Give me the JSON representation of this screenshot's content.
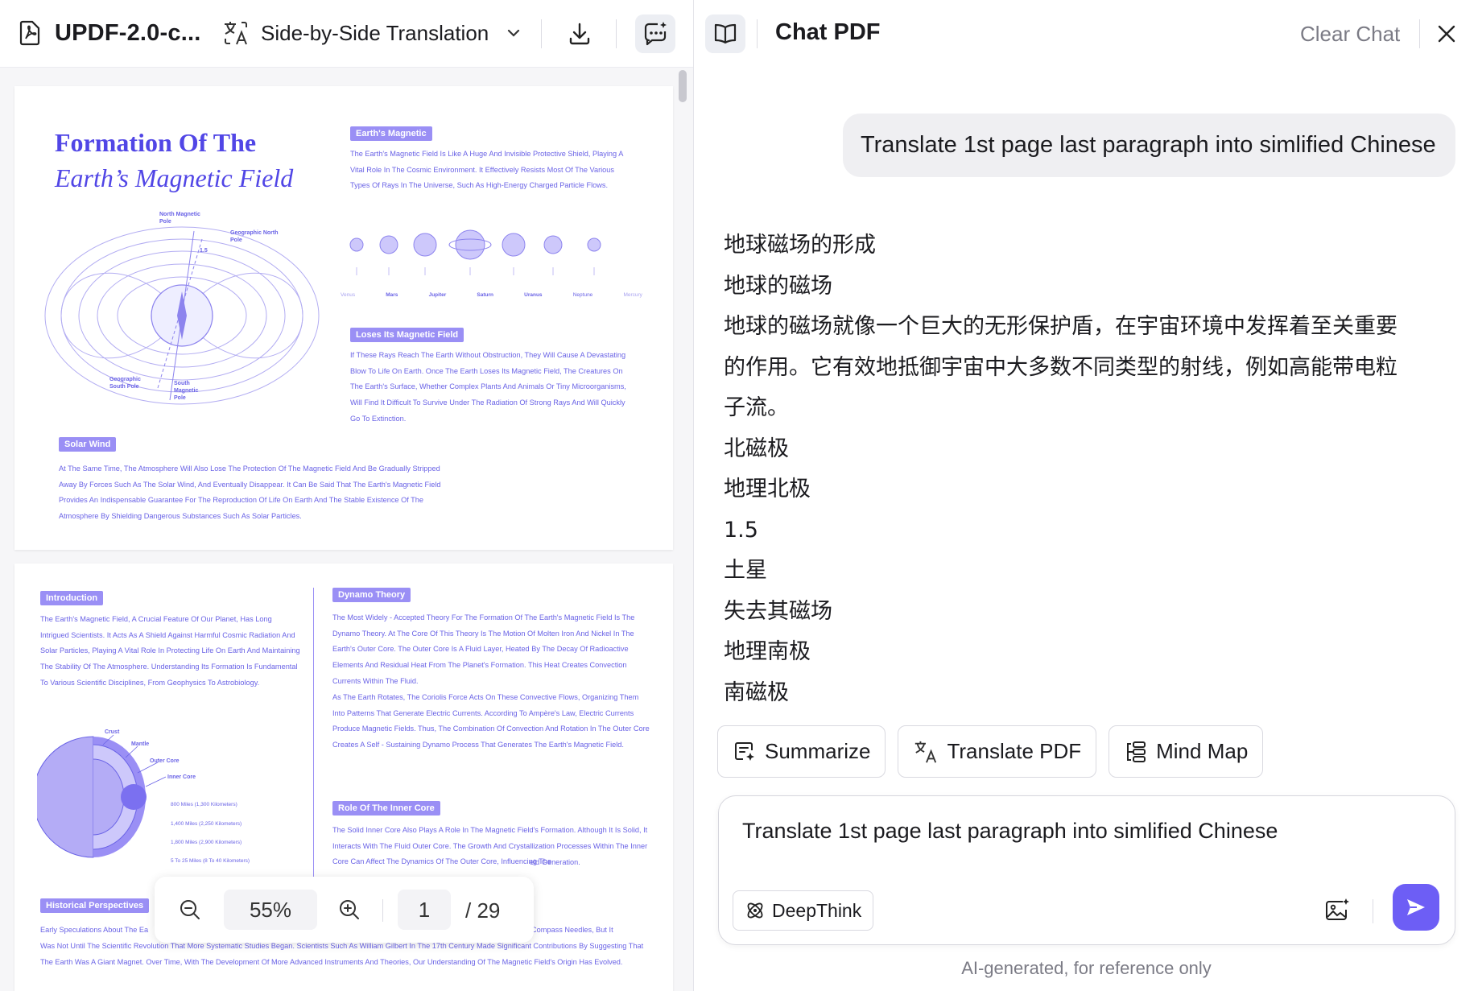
{
  "toolbar": {
    "file_name": "UPDF-2.0-c...",
    "translation_mode": "Side-by-Side Translation"
  },
  "page1": {
    "title_line1": "Formation Of The",
    "title_line2": "Earth’s Magnetic Field",
    "badge_magnetic": "Earth's Magnetic",
    "magnetic_text": "The Earth's Magnetic Field Is Like A Huge And Invisible Protective Shield, Playing A Vital Role In The Cosmic Environment. It Effectively Resists Most Of The Various Types Of Rays In The Universe, Such As High-Energy Charged Particle Flows.",
    "planets": [
      "Venus",
      "Mars",
      "Jupiter",
      "Saturn",
      "Uranus",
      "Neptune",
      "Mercury"
    ],
    "badge_loses": "Loses Its Magnetic Field",
    "loses_text": "If These Rays Reach The Earth Without Obstruction, They Will Cause A Devastating Blow To Life On Earth. Once The Earth Loses Its Magnetic Field, The Creatures On The Earth's Surface, Whether Complex Plants And Animals Or Tiny Microorganisms, Will Find It Difficult To Survive Under The Radiation Of Strong Rays And Will Quickly Go To Extinction.",
    "diagram_labels": {
      "north_magnetic": "North Magnetic Pole",
      "geo_north": "Geographic North Pole",
      "angle": "1.5",
      "geo_south": "Geographic South Pole",
      "south_magnetic": "South Magnetic Pole"
    },
    "badge_solar": "Solar Wind",
    "solar_text": "At The Same Time, The Atmosphere Will Also Lose The Protection Of The Magnetic Field And Be Gradually Stripped Away By Forces Such As The Solar Wind, And Eventually Disappear. It Can Be Said That The Earth's Magnetic Field Provides An Indispensable Guarantee For The Reproduction Of Life On Earth And The Stable Existence Of The Atmosphere By Shielding Dangerous Substances Such As Solar Particles."
  },
  "page2": {
    "badge_intro": "Introduction",
    "intro_text": "The Earth's Magnetic Field, A Crucial Feature Of Our Planet, Has Long Intrigued Scientists. It Acts As A Shield Against Harmful Cosmic Radiation And Solar Particles, Playing A Vital Role In Protecting Life On Earth And Maintaining The Stability Of The Atmosphere. Understanding Its Formation Is Fundamental To Various Scientific Disciplines, From Geophysics To Astrobiology.",
    "layers": {
      "crust": "Crust",
      "mantle": "Mantle",
      "outer": "Outer Core",
      "inner": "Inner Core"
    },
    "depths": [
      "800 Miles (1,300 Kilometers)",
      "1,400 Miles (2,250 Kilometers)",
      "1,800 Miles (2,900 Kilometers)",
      "5 To 25 Miles (8 To 40 Kilometers)"
    ],
    "badge_dynamo": "Dynamo Theory",
    "dynamo_text": "The Most Widely - Accepted Theory For The Formation Of The Earth's Magnetic Field Is The Dynamo Theory. At The Core Of This Theory Is The Motion Of Molten Iron And Nickel In The Earth's Outer Core. The Outer Core Is A Fluid Layer, Heated By The Decay Of Radioactive Elements And Residual Heat From The Planet's Formation. This Heat Creates Convection Currents Within The Fluid.",
    "dynamo_text2": "As The Earth Rotates, The Coriolis Force Acts On These Convective Flows, Organizing Them Into Patterns That Generate Electric Currents. According To Ampère's Law, Electric Currents Produce Magnetic Fields. Thus, The Combination Of Convection And Rotation In The Outer Core Creates A Self - Sustaining Dynamo Process That Generates The Earth's Magnetic Field.",
    "badge_inner": "Role Of The Inner Core",
    "inner_text": "The Solid Inner Core Also Plays A Role In The Magnetic Field's Formation. Although It Is Solid, It Interacts With The Fluid Outer Core. The Growth And Crystallization Processes Within The Inner Core Can Affect The Dynamics Of The Outer Core, Influencing The",
    "inner_tail": "eld Generation.",
    "badge_hist": "Historical Perspectives",
    "hist_text": "Early Speculations About The Ea",
    "hist_right": "Compass Needles, But It",
    "hist_text2": "Was Not Until The Scientific Revolution That More Systematic Studies Began. Scientists Such As William Gilbert In The 17th Century Made Significant Contributions By Suggesting That The Earth Was A Giant Magnet. Over Time, With The Development Of More Advanced Instruments And Theories, Our Understanding Of The Magnetic Field's Origin Has Evolved."
  },
  "zoom": {
    "level": "55%",
    "current_page": "1",
    "total_pages": "/ 29"
  },
  "chat": {
    "title": "Chat PDF",
    "clear_label": "Clear Chat",
    "user_message": "Translate 1st page last paragraph into simlified Chinese",
    "answer_lines": [
      "地球磁场的形成",
      "地球的磁场",
      "地球的磁场就像一个巨大的无形保护盾，在宇宙环境中发挥着至关重要",
      "的作用。它有效地抵御宇宙中大多数不同类型的射线，例如高能带电粒",
      "子流。",
      "北磁极",
      "地理北极",
      "1.5",
      "土星",
      "失去其磁场",
      "地理南极",
      "南磁极"
    ],
    "chips": {
      "summarize": "Summarize",
      "translate": "Translate PDF",
      "mindmap": "Mind Map"
    },
    "input_value": "Translate 1st page last paragraph into simlified Chinese",
    "deepthink_label": "DeepThink",
    "disclaimer": "AI-generated, for reference only"
  },
  "colors": {
    "accent": "#6d5ef5",
    "pdf_text": "#6a63e6",
    "pdf_badge": "#9a8ff5"
  }
}
